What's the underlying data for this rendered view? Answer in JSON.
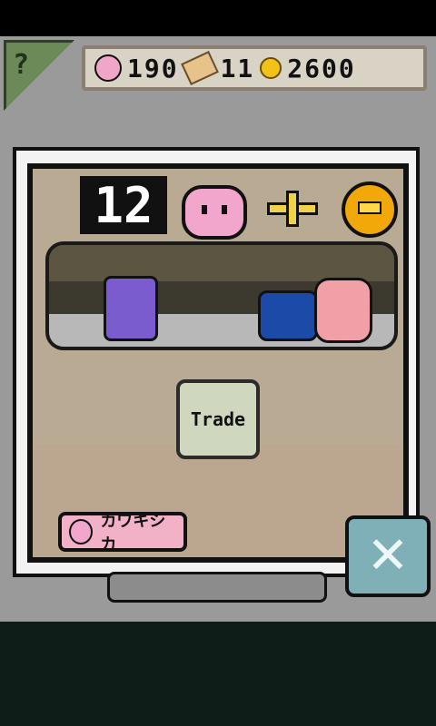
{
  "help": {
    "icon_label": "?"
  },
  "resources": {
    "pink_count": "190",
    "ticket_count": "11",
    "coin_count": "2600"
  },
  "trade_panel": {
    "counter": "12",
    "button_label": "Trade",
    "collection_label": "カワキシカ"
  },
  "close_button": {
    "label": "✕"
  },
  "icons": {
    "pink": "pink-blob-icon",
    "ticket": "ticket-icon",
    "coin": "coin-icon",
    "plus": "plus-icon",
    "close": "close-icon"
  }
}
